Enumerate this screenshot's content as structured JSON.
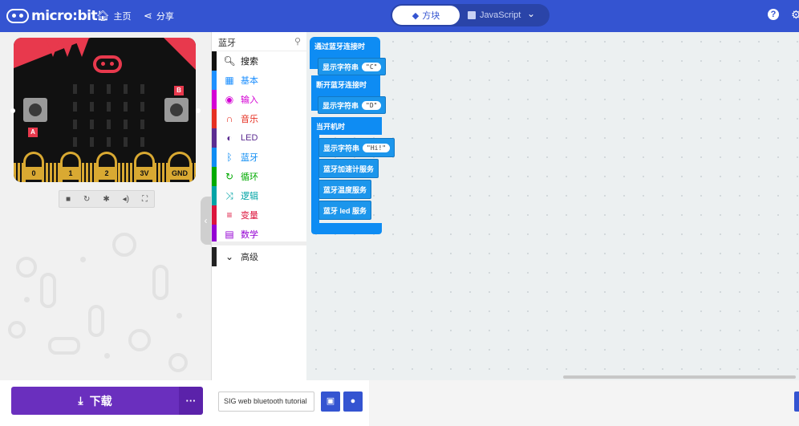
{
  "header": {
    "brand": "micro:bit",
    "home_label": "主页",
    "share_label": "分享",
    "blocks_label": "方块",
    "javascript_label": "JavaScript",
    "help_glyph": "?",
    "settings_glyph": "⚙"
  },
  "colors": {
    "header_bg": "#3454d1",
    "download_bg": "#6a2fbe",
    "bluetooth_block": "#0e8cf3",
    "microbit_red": "#e8394d",
    "pin_gold": "#d9a932"
  },
  "simulator": {
    "pins": [
      "0",
      "1",
      "2",
      "3V",
      "GND"
    ],
    "button_a": "A",
    "button_b": "B",
    "controls": [
      "stop-icon",
      "restart-icon",
      "slowmo-icon",
      "mute-icon",
      "fullscreen-icon"
    ]
  },
  "toolbox": {
    "search_value": "蓝牙",
    "categories": [
      {
        "label": "搜索",
        "icon": "search-icon",
        "color": "#111111"
      },
      {
        "label": "基本",
        "icon": "grid-icon",
        "color": "#1e90ff"
      },
      {
        "label": "输入",
        "icon": "target-icon",
        "color": "#d400d4"
      },
      {
        "label": "音乐",
        "icon": "headphones-icon",
        "color": "#e63022"
      },
      {
        "label": "LED",
        "icon": "toggle-icon",
        "color": "#5c2d91"
      },
      {
        "label": "蓝牙",
        "icon": "bluetooth-icon",
        "color": "#0e8cf3"
      },
      {
        "label": "循环",
        "icon": "refresh-icon",
        "color": "#00aa00"
      },
      {
        "label": "逻辑",
        "icon": "shuffle-icon",
        "color": "#00a4a6"
      },
      {
        "label": "变量",
        "icon": "list-icon",
        "color": "#dc143c"
      },
      {
        "label": "数学",
        "icon": "calculator-icon",
        "color": "#9400d3"
      }
    ],
    "advanced_label": "高级"
  },
  "workspace": {
    "blocks": {
      "on_connected": "通过蓝牙连接时",
      "show_c": "显示字符串",
      "c_value": "\"C\"",
      "on_disconnected": "断开蓝牙连接时",
      "show_d": "显示字符串",
      "d_value": "\"D\"",
      "on_start": "当开机时",
      "show_hi": "显示字符串",
      "hi_value": "\"Hi!\"",
      "accel_service": "蓝牙加速计服务",
      "temp_service": "蓝牙温度服务",
      "led_service": "蓝牙 led 服务"
    }
  },
  "bottom": {
    "download_label": "下载",
    "more_label": "···",
    "project_name": "SIG web bluetooth tutorial"
  }
}
